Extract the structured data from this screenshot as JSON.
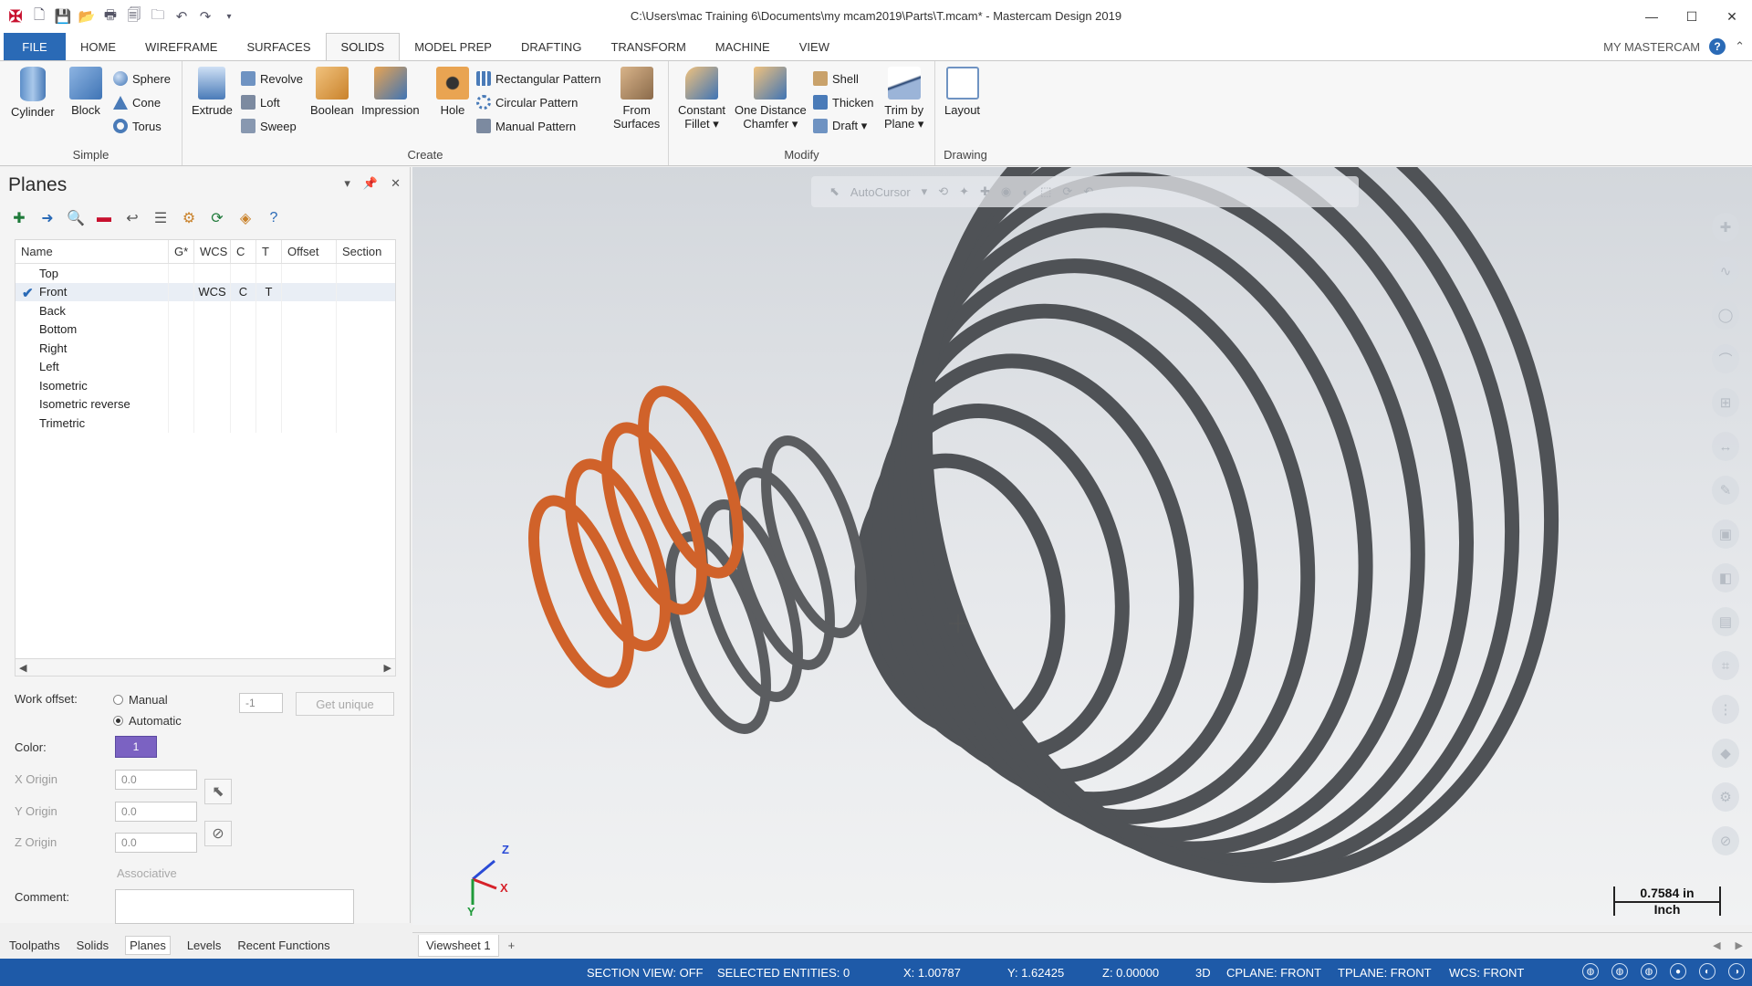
{
  "window": {
    "title": "C:\\Users\\mac Training 6\\Documents\\my mcam2019\\Parts\\T.mcam* - Mastercam Design 2019",
    "minimize": "—",
    "maximize": "☐",
    "close": "✕"
  },
  "tabs": {
    "items": [
      "FILE",
      "HOME",
      "WIREFRAME",
      "SURFACES",
      "SOLIDS",
      "MODEL PREP",
      "DRAFTING",
      "TRANSFORM",
      "MACHINE",
      "VIEW"
    ],
    "active": "SOLIDS",
    "my_mastercam": "MY MASTERCAM",
    "help": "?",
    "collapse": "⌃"
  },
  "ribbon": {
    "simple": {
      "label": "Simple",
      "cylinder": "Cylinder",
      "block": "Block",
      "sphere": "Sphere",
      "cone": "Cone",
      "torus": "Torus"
    },
    "create": {
      "label": "Create",
      "extrude": "Extrude",
      "revolve": "Revolve",
      "loft": "Loft",
      "sweep": "Sweep",
      "boolean": "Boolean",
      "impression": "Impression",
      "hole": "Hole",
      "rectangular_pattern": "Rectangular Pattern",
      "circular_pattern": "Circular Pattern",
      "manual_pattern": "Manual Pattern",
      "from_surfaces_1": "From",
      "from_surfaces_2": "Surfaces"
    },
    "modify": {
      "label": "Modify",
      "constant_fillet_1": "Constant",
      "constant_fillet_2": "Fillet ▾",
      "one_distance_1": "One Distance",
      "one_distance_2": "Chamfer ▾",
      "shell": "Shell",
      "thicken": "Thicken",
      "draft": "Draft ▾",
      "trim_1": "Trim by",
      "trim_2": "Plane ▾"
    },
    "drawing": {
      "label": "Drawing",
      "layout": "Layout"
    }
  },
  "planes_panel": {
    "title": "Planes",
    "columns": [
      "Name",
      "G*",
      "WCS",
      "C",
      "T",
      "Offset",
      "Section"
    ],
    "rows": [
      {
        "name": "Top",
        "wcs": "",
        "c": "",
        "t": ""
      },
      {
        "name": "Front",
        "wcs": "WCS",
        "c": "C",
        "t": "T"
      },
      {
        "name": "Back",
        "wcs": "",
        "c": "",
        "t": ""
      },
      {
        "name": "Bottom",
        "wcs": "",
        "c": "",
        "t": ""
      },
      {
        "name": "Right",
        "wcs": "",
        "c": "",
        "t": ""
      },
      {
        "name": "Left",
        "wcs": "",
        "c": "",
        "t": ""
      },
      {
        "name": "Isometric",
        "wcs": "",
        "c": "",
        "t": ""
      },
      {
        "name": "Isometric reverse",
        "wcs": "",
        "c": "",
        "t": ""
      },
      {
        "name": "Trimetric",
        "wcs": "",
        "c": "",
        "t": ""
      }
    ],
    "work_offset_label": "Work offset:",
    "manual": "Manual",
    "automatic": "Automatic",
    "offset_value": "-1",
    "get_unique": "Get unique",
    "color_label": "Color:",
    "color_value": "1",
    "x_origin_label": "X Origin",
    "y_origin_label": "Y Origin",
    "z_origin_label": "Z Origin",
    "x_origin": "0.0",
    "y_origin": "0.0",
    "z_origin": "0.0",
    "associative": "Associative",
    "comment_label": "Comment:"
  },
  "bottom_tabs": [
    "Toolpaths",
    "Solids",
    "Planes",
    "Levels",
    "Recent Functions"
  ],
  "viewport": {
    "autocursor": "AutoCursor",
    "scale_value": "0.7584 in",
    "scale_unit": "Inch",
    "axis_x": "X",
    "axis_y": "Y",
    "axis_z": "Z"
  },
  "viewsheets": {
    "tab": "Viewsheet 1",
    "add": "+"
  },
  "status": {
    "section_view": "SECTION VIEW: OFF",
    "selected": "SELECTED ENTITIES: 0",
    "x": "X:  1.00787",
    "y": "Y:  1.62425",
    "z": "Z:  0.00000",
    "mode": "3D",
    "cplane": "CPLANE: FRONT",
    "tplane": "TPLANE: FRONT",
    "wcs": "WCS: FRONT"
  },
  "colors": {
    "accent": "#2a6ab6",
    "status_bar": "#1e5aa8",
    "spring_orange": "#d0622a",
    "spring_gray": "#5b5d60",
    "plane_color": "#7b62c2"
  }
}
